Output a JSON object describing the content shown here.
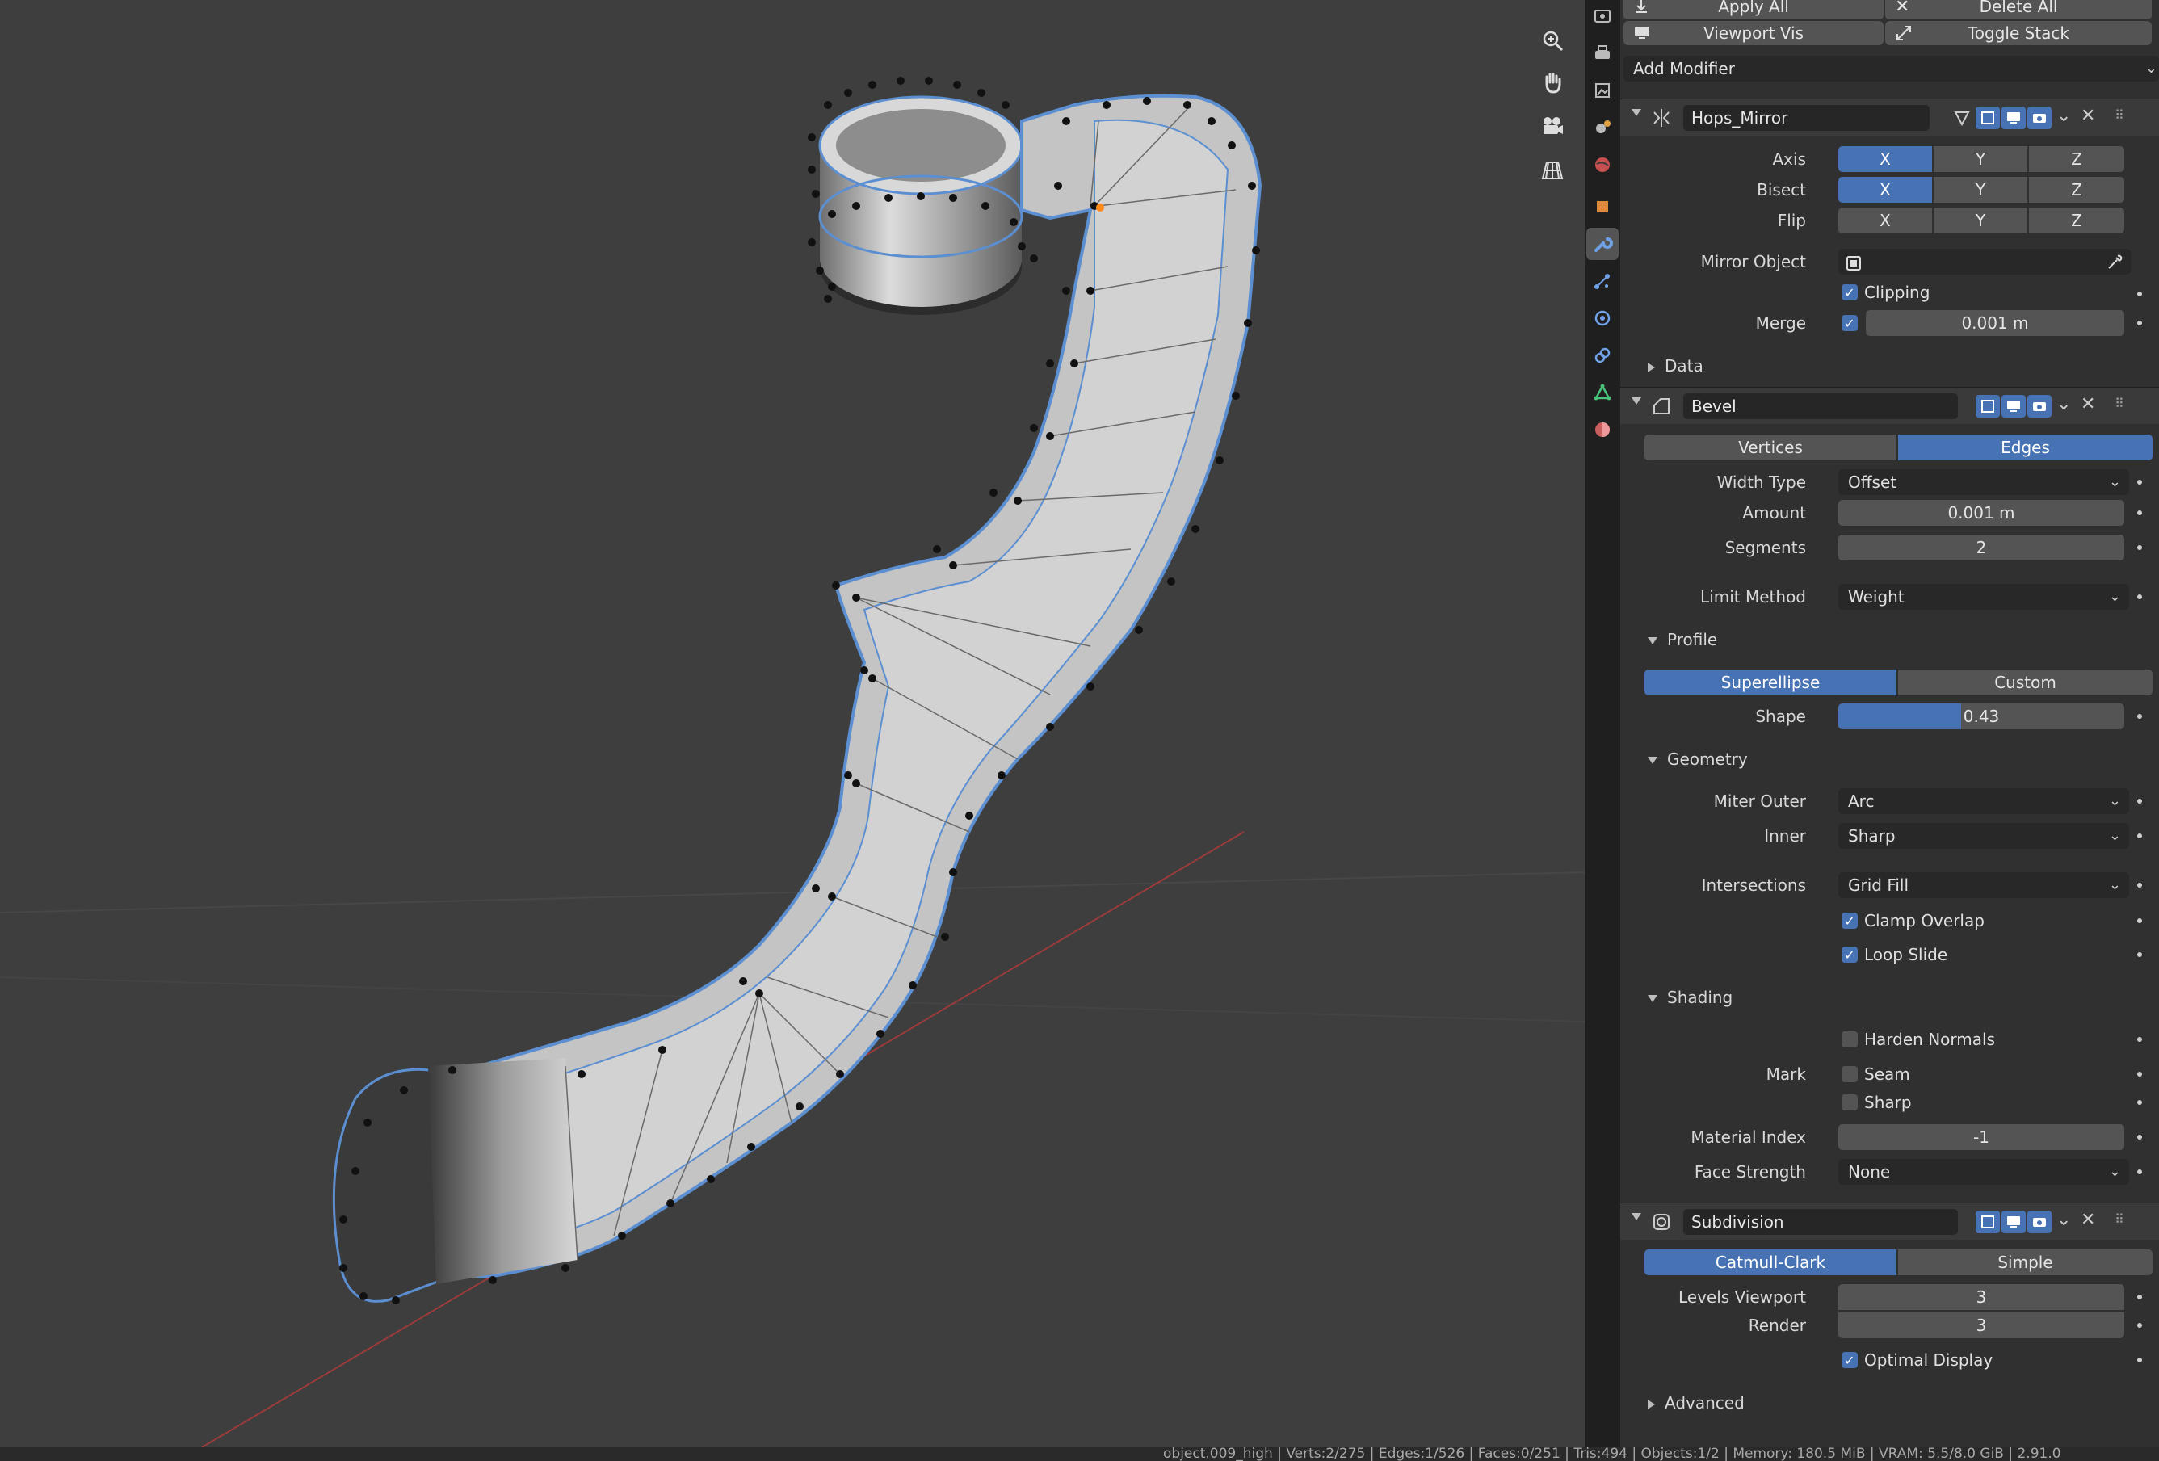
{
  "top_buttons": {
    "apply_all": "Apply All",
    "delete_all": "Delete All",
    "viewport_vis": "Viewport Vis",
    "toggle_stack": "Toggle Stack",
    "add_modifier": "Add Modifier"
  },
  "mirror": {
    "name": "Hops_Mirror",
    "axis_label": "Axis",
    "bisect_label": "Bisect",
    "flip_label": "Flip",
    "x": "X",
    "y": "Y",
    "z": "Z",
    "mirror_object_label": "Mirror Object",
    "clipping_label": "Clipping",
    "merge_label": "Merge",
    "merge_value": "0.001 m",
    "data_label": "Data"
  },
  "bevel": {
    "name": "Bevel",
    "vertices": "Vertices",
    "edges": "Edges",
    "width_type_label": "Width Type",
    "width_type_value": "Offset",
    "amount_label": "Amount",
    "amount_value": "0.001 m",
    "segments_label": "Segments",
    "segments_value": "2",
    "limit_method_label": "Limit Method",
    "limit_method_value": "Weight",
    "profile_label": "Profile",
    "superellipse": "Superellipse",
    "custom": "Custom",
    "shape_label": "Shape",
    "shape_value": "0.43",
    "shape_fraction": 0.43,
    "geometry_label": "Geometry",
    "miter_outer_label": "Miter Outer",
    "miter_outer_value": "Arc",
    "inner_label": "Inner",
    "inner_value": "Sharp",
    "intersections_label": "Intersections",
    "intersections_value": "Grid Fill",
    "clamp_overlap_label": "Clamp Overlap",
    "loop_slide_label": "Loop Slide",
    "shading_label": "Shading",
    "harden_normals_label": "Harden Normals",
    "mark_label": "Mark",
    "seam_label": "Seam",
    "sharp_label": "Sharp",
    "material_index_label": "Material Index",
    "material_index_value": "-1",
    "face_strength_label": "Face Strength",
    "face_strength_value": "None"
  },
  "subdivision": {
    "name": "Subdivision",
    "catmull_clark": "Catmull-Clark",
    "simple": "Simple",
    "levels_viewport_label": "Levels Viewport",
    "levels_viewport_value": "3",
    "render_label": "Render",
    "render_value": "3",
    "optimal_display_label": "Optimal Display",
    "advanced_label": "Advanced"
  },
  "status": {
    "text": "object.009_high | Verts:2/275 | Edges:1/526 | Faces:0/251 | Tris:494 | Objects:1/2 | Memory: 180.5 MiB | VRAM: 5.5/8.0 GiB | 2.91.0"
  },
  "colors": {
    "accent": "#4772b3",
    "panel_bg": "#303030",
    "viewport_bg": "#3e3e3e"
  }
}
